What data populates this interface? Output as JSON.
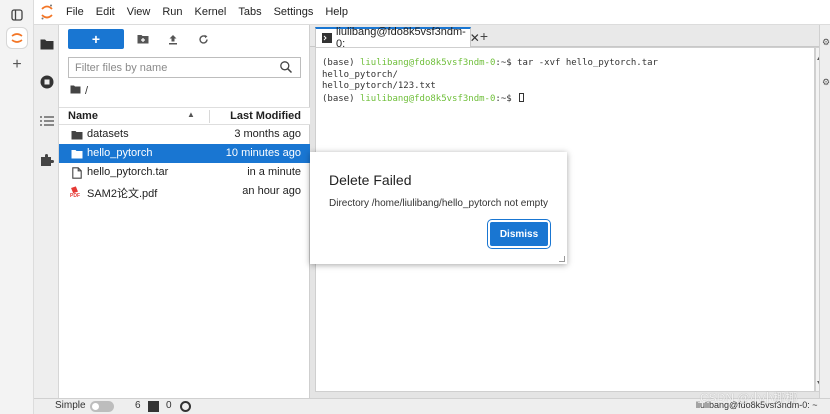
{
  "menu": [
    "File",
    "Edit",
    "View",
    "Run",
    "Kernel",
    "Tabs",
    "Settings",
    "Help"
  ],
  "file_browser": {
    "new_button_label": "+",
    "filter_placeholder": "Filter files by name",
    "breadcrumb": "/",
    "columns": {
      "name": "Name",
      "modified": "Last Modified"
    },
    "files": [
      {
        "name": "datasets",
        "modified": "3 months ago",
        "icon": "folder-icon"
      },
      {
        "name": "hello_pytorch",
        "modified": "10 minutes ago",
        "icon": "folder-icon",
        "selected": true
      },
      {
        "name": "hello_pytorch.tar",
        "modified": "in a minute",
        "icon": "file-icon"
      },
      {
        "name": "SAM2论文.pdf",
        "modified": "an hour ago",
        "icon": "pdf-icon"
      }
    ]
  },
  "terminal": {
    "tab_title": "liulibang@fdo8k5vsf3ndm-0:",
    "lines": [
      {
        "prefix": "(base) ",
        "prompt": "liulibang@fdo8k5vsf3ndm-0",
        "suffix": ":~$ tar -xvf hello_pytorch.tar"
      },
      {
        "text": "hello_pytorch/"
      },
      {
        "text": "hello_pytorch/123.txt"
      },
      {
        "prefix": "(base) ",
        "prompt": "liulibang@fdo8k5vsf3ndm-0",
        "suffix": ":~$ "
      }
    ]
  },
  "dialog": {
    "title": "Delete Failed",
    "message": "Directory /home/liulibang/hello_pytorch not empty",
    "button": "Dismiss"
  },
  "statusbar": {
    "mode_label": "Simple",
    "terminals_count": "6",
    "kernels_count": "0",
    "right_text": "liulibang@fdo8k5vsf3ndm-0: ~"
  },
  "watermark": "CSDN @小小椰椰",
  "colors": {
    "accent": "#1976d2",
    "prompt_green": "#6fbf3a",
    "logo_orange": "#f37626"
  }
}
